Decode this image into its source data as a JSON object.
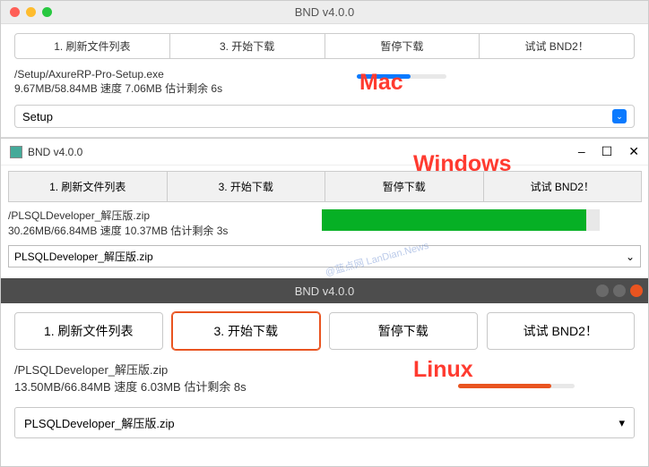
{
  "mac": {
    "title": "BND v4.0.0",
    "buttons": {
      "refresh": "1. 刷新文件列表",
      "start": "3. 开始下载",
      "pause": "暂停下载",
      "try": "试试 BND2！"
    },
    "file_path": "/Setup/AxureRP-Pro-Setup.exe",
    "status": "9.67MB/58.84MB 速度 7.06MB 估计剩余 6s",
    "select_value": "Setup",
    "progress_percent": 60
  },
  "windows": {
    "title": "BND v4.0.0",
    "buttons": {
      "refresh": "1. 刷新文件列表",
      "start": "3. 开始下载",
      "pause": "暂停下载",
      "try": "试试 BND2！"
    },
    "file_path": "/PLSQLDeveloper_解压版.zip",
    "status": "30.26MB/66.84MB 速度 10.37MB 估计剩余 3s",
    "select_value": "PLSQLDeveloper_解压版.zip",
    "progress_percent": 95
  },
  "linux": {
    "title": "BND v4.0.0",
    "buttons": {
      "refresh": "1. 刷新文件列表",
      "start": "3. 开始下载",
      "pause": "暂停下载",
      "try": "试试 BND2！"
    },
    "file_path": "/PLSQLDeveloper_解压版.zip",
    "status": "13.50MB/66.84MB 速度 6.03MB 估计剩余 8s",
    "select_value": "PLSQLDeveloper_解压版.zip",
    "progress_percent": 80
  },
  "labels": {
    "mac": "Mac",
    "windows": "Windows",
    "linux": "Linux"
  },
  "watermark": "@蓝点网 LanDian.News"
}
